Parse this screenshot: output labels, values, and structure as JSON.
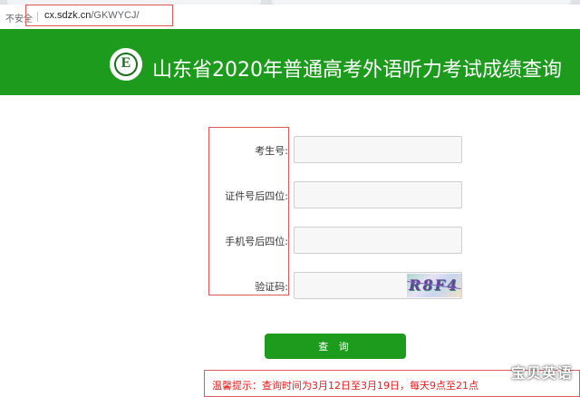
{
  "browser": {
    "security_label": "不安全",
    "url_host": "cx.sdzk.cn",
    "url_path": "/GKWYCJ/"
  },
  "header": {
    "logo_letter": "E",
    "title": "山东省2020年普通高考外语听力考试成绩查询"
  },
  "form": {
    "exam_id_label": "考生号:",
    "id_last4_label": "证件号后四位:",
    "phone_last4_label": "手机号后四位:",
    "captcha_label": "验证码:",
    "captcha_chars": "R8F4"
  },
  "actions": {
    "query_label": "查 询"
  },
  "notice": {
    "text": "温馨提示：查询时间为3月12日至3月19日，每天9点至21点"
  },
  "watermark": "宝贝英语",
  "colors": {
    "brand_green": "#1d9b1d",
    "highlight_red": "#e05a5a",
    "notice_red": "#e02020"
  }
}
